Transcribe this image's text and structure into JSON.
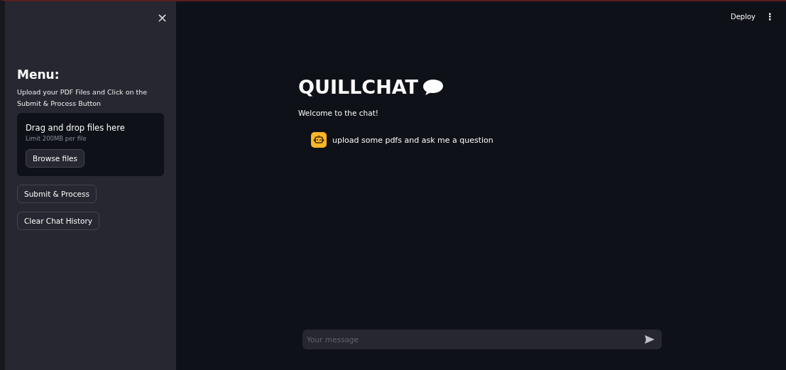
{
  "sidebar": {
    "close": "×",
    "heading": "Menu:",
    "instructions": "Upload your PDF Files and Click on the Submit & Process Button",
    "uploader": {
      "title": "Drag and drop files here",
      "limit": "Limit 200MB per file",
      "button": "Browse files"
    },
    "buttons": [
      "Submit & Process",
      "Clear Chat History"
    ]
  },
  "header": {
    "deploy": "Deploy",
    "menu": "⋮"
  },
  "main": {
    "title": "QUILLCHAT",
    "subtitle": "Welcome to the chat!",
    "messages": [
      {
        "kind": "assistant",
        "text": "upload some pdfs and ask me a question"
      }
    ]
  },
  "chat_input": {
    "placeholder": "Your message"
  }
}
